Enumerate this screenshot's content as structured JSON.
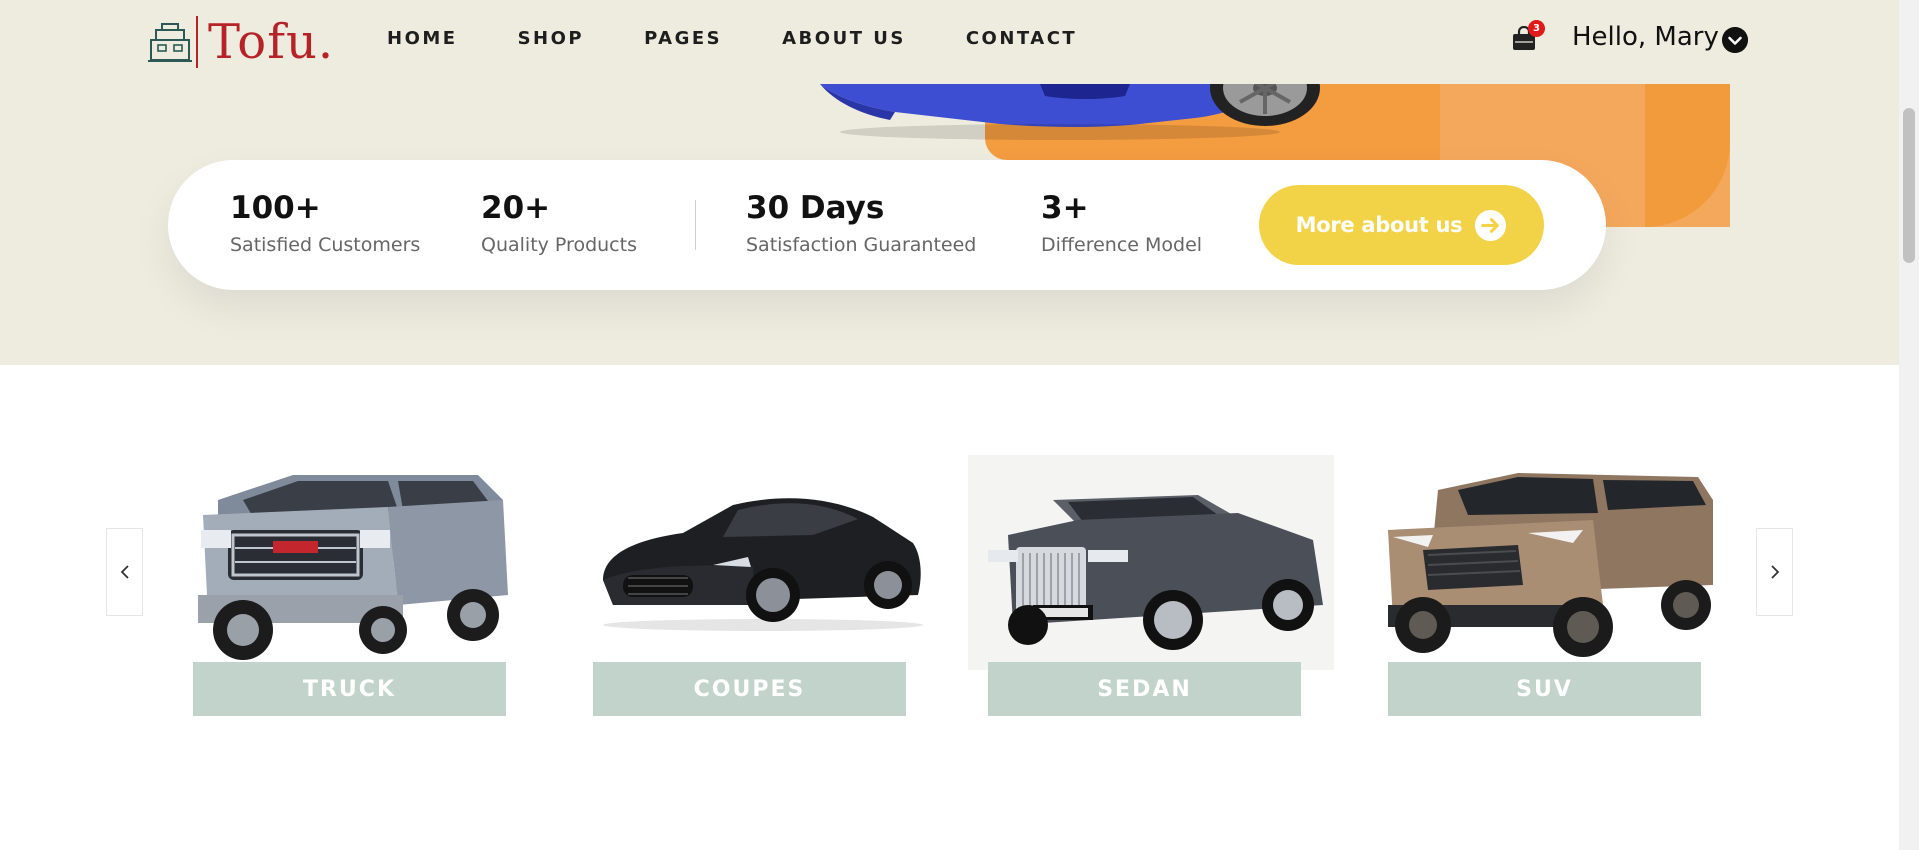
{
  "header": {
    "logo_text": "Tofu.",
    "nav": [
      "HOME",
      "SHOP",
      "PAGES",
      "ABOUT US",
      "CONTACT"
    ],
    "cart_count": "3",
    "greeting": "Hello, Mary"
  },
  "stats": [
    {
      "value": "100+",
      "label": "Satisfied Customers"
    },
    {
      "value": "20+",
      "label": "Quality Products"
    },
    {
      "value": "30 Days",
      "label": "Satisfaction Guaranteed"
    },
    {
      "value": "3+",
      "label": "Difference Model"
    }
  ],
  "cta": {
    "label": "More about us"
  },
  "categories": [
    "TRUCK",
    "COUPES",
    "SEDAN",
    "SUV"
  ],
  "colors": {
    "hero_bg": "#eeebdf",
    "brand_red": "#b52228",
    "cta_yellow": "#f2d347",
    "category_label_bg": "#c2d3cc",
    "accent_orange": "#f39c40"
  },
  "icons": {
    "cart": "shopping-bag-icon",
    "chevron": "chevron-down-icon",
    "cta": "arrow-right-circle-icon",
    "prev": "chevron-left-icon",
    "next": "chevron-right-icon"
  }
}
